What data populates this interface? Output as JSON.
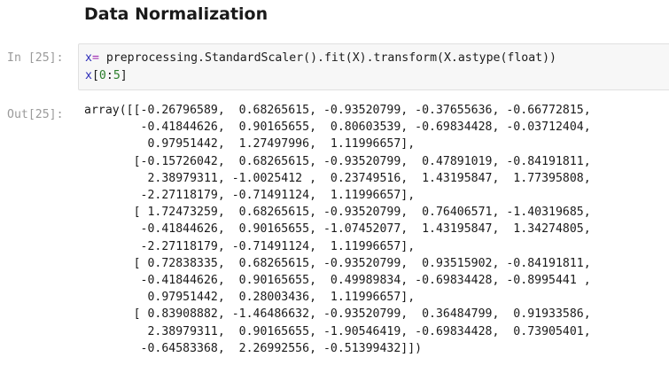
{
  "heading": "Data Normalization",
  "cell": {
    "in_prompt": "In [25]:",
    "out_prompt": "Out[25]:",
    "code": {
      "line1": {
        "var": "x",
        "op": "=",
        "rest": " preprocessing.StandardScaler().fit(X).transform(X.astype(float))"
      },
      "line2": {
        "var": "x",
        "rest": "[",
        "num1": "0",
        "colon": ":",
        "num2": "5",
        "end": "]"
      }
    },
    "output_lines": [
      "array([[-0.26796589,  0.68265615, -0.93520799, -0.37655636, -0.66772815,",
      "        -0.41844626,  0.90165655,  0.80603539, -0.69834428, -0.03712404,",
      "         0.97951442,  1.27497996,  1.11996657],",
      "       [-0.15726042,  0.68265615, -0.93520799,  0.47891019, -0.84191811,",
      "         2.38979311, -1.0025412 ,  0.23749516,  1.43195847,  1.77395808,",
      "        -2.27118179, -0.71491124,  1.11996657],",
      "       [ 1.72473259,  0.68265615, -0.93520799,  0.76406571, -1.40319685,",
      "        -0.41844626,  0.90165655, -1.07452077,  1.43195847,  1.34274805,",
      "        -2.27118179, -0.71491124,  1.11996657],",
      "       [ 0.72838335,  0.68265615, -0.93520799,  0.93515902, -0.84191811,",
      "        -0.41844626,  0.90165655,  0.49989834, -0.69834428, -0.8995441 ,",
      "         0.97951442,  0.28003436,  1.11996657],",
      "       [ 0.83908882, -1.46486632, -0.93520799,  0.36484799,  0.91933586,",
      "         2.38979311,  0.90165655, -1.90546419, -0.69834428,  0.73905401,",
      "        -0.64583368,  2.26992556, -0.51399432]])"
    ]
  }
}
